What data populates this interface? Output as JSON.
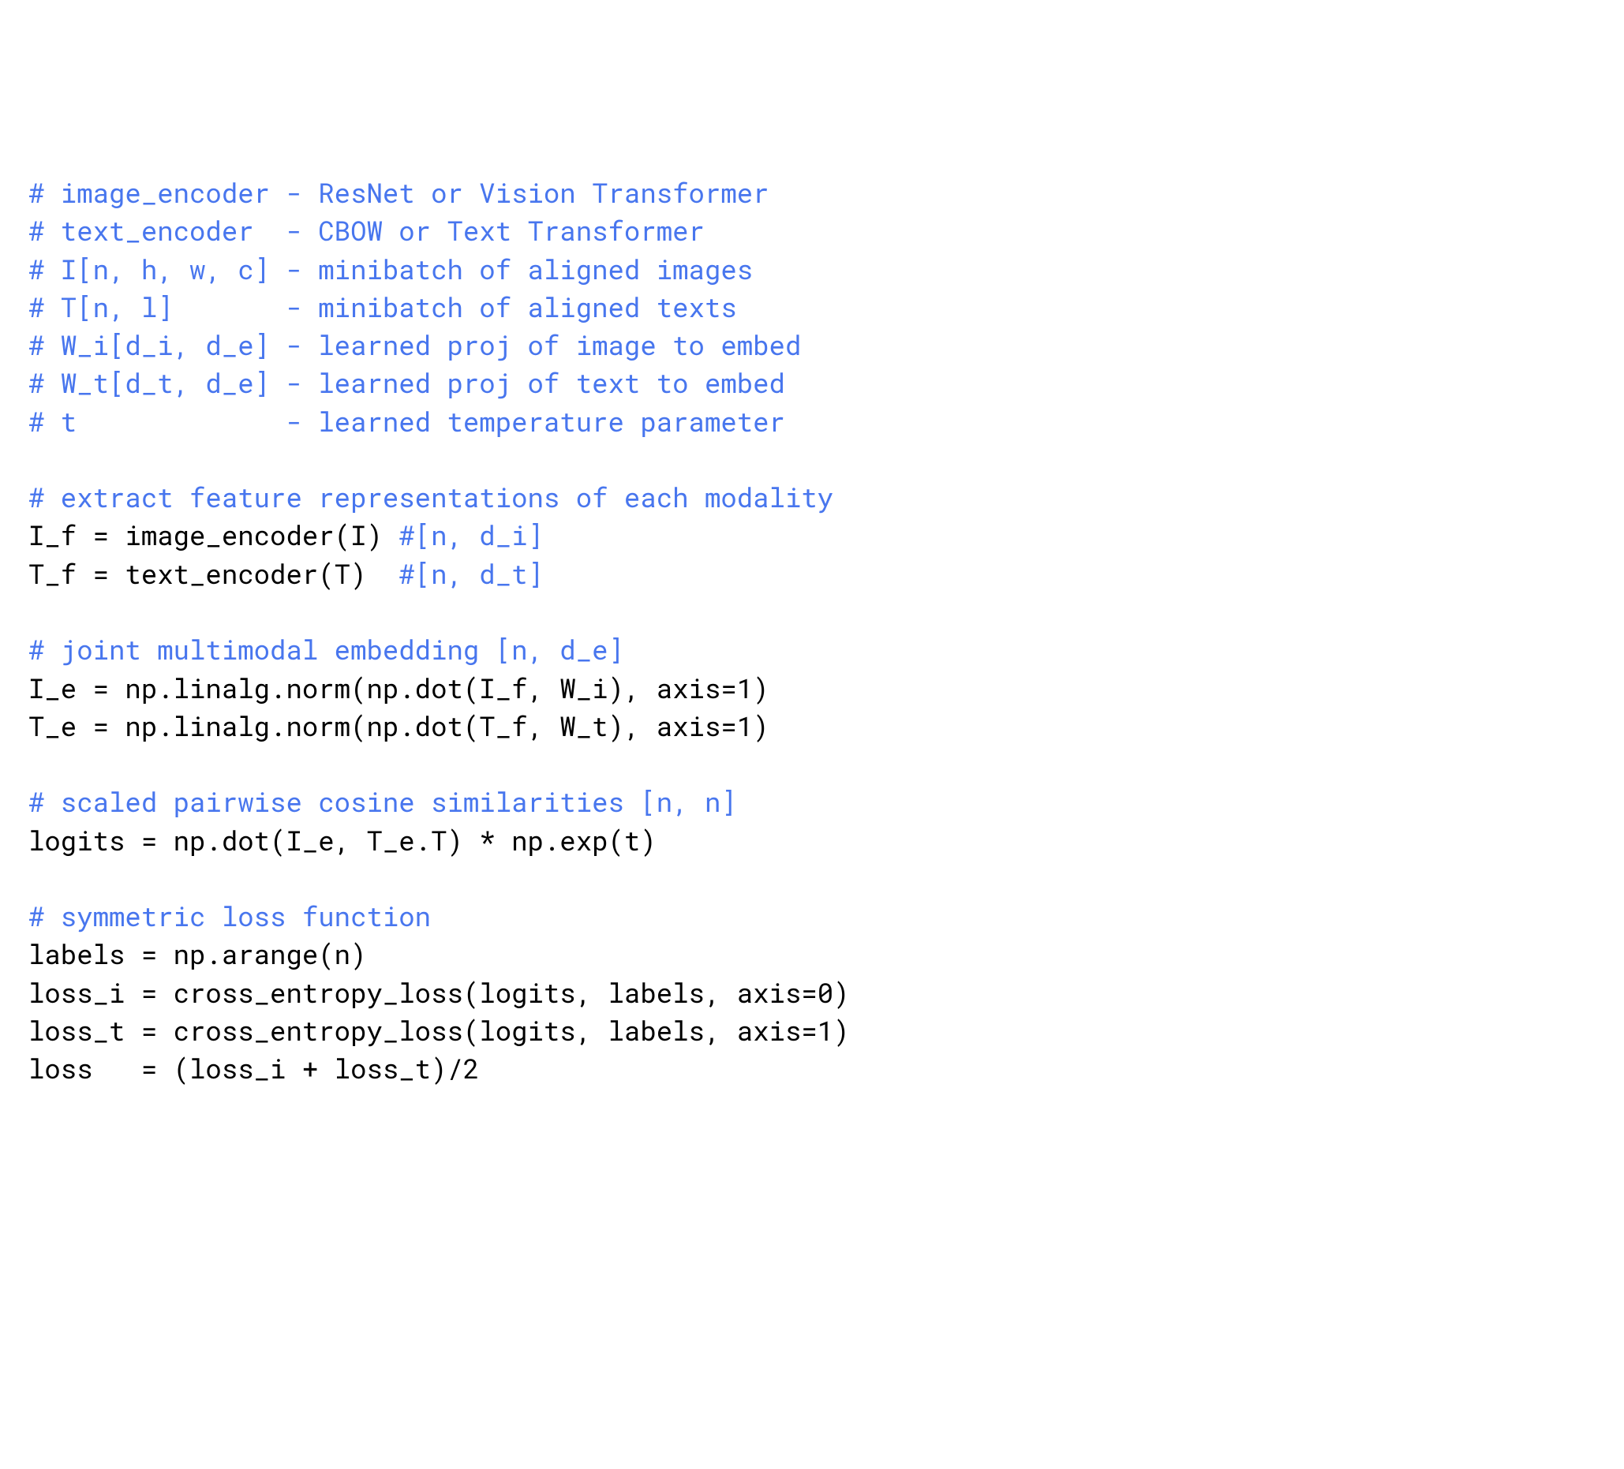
{
  "lines": [
    {
      "segments": [
        {
          "text": "# image_encoder - ResNet or Vision Transformer",
          "type": "comment"
        }
      ]
    },
    {
      "segments": [
        {
          "text": "# text_encoder  - CBOW or Text Transformer",
          "type": "comment"
        }
      ]
    },
    {
      "segments": [
        {
          "text": "# I[n, h, w, c] - minibatch of aligned images",
          "type": "comment"
        }
      ]
    },
    {
      "segments": [
        {
          "text": "# T[n, l]       - minibatch of aligned texts",
          "type": "comment"
        }
      ]
    },
    {
      "segments": [
        {
          "text": "# W_i[d_i, d_e] - learned proj of image to embed",
          "type": "comment"
        }
      ]
    },
    {
      "segments": [
        {
          "text": "# W_t[d_t, d_e] - learned proj of text to embed",
          "type": "comment"
        }
      ]
    },
    {
      "segments": [
        {
          "text": "# t             - learned temperature parameter",
          "type": "comment"
        }
      ]
    },
    {
      "segments": [
        {
          "text": "",
          "type": "code"
        }
      ]
    },
    {
      "segments": [
        {
          "text": "# extract feature representations of each modality",
          "type": "comment"
        }
      ]
    },
    {
      "segments": [
        {
          "text": "I_f = image_encoder(I) ",
          "type": "code"
        },
        {
          "text": "#[n, d_i]",
          "type": "comment"
        }
      ]
    },
    {
      "segments": [
        {
          "text": "T_f = text_encoder(T)  ",
          "type": "code"
        },
        {
          "text": "#[n, d_t]",
          "type": "comment"
        }
      ]
    },
    {
      "segments": [
        {
          "text": "",
          "type": "code"
        }
      ]
    },
    {
      "segments": [
        {
          "text": "# joint multimodal embedding [n, d_e]",
          "type": "comment"
        }
      ]
    },
    {
      "segments": [
        {
          "text": "I_e = np.linalg.norm(np.dot(I_f, W_i), axis=1)",
          "type": "code"
        }
      ]
    },
    {
      "segments": [
        {
          "text": "T_e = np.linalg.norm(np.dot(T_f, W_t), axis=1)",
          "type": "code"
        }
      ]
    },
    {
      "segments": [
        {
          "text": "",
          "type": "code"
        }
      ]
    },
    {
      "segments": [
        {
          "text": "# scaled pairwise cosine similarities [n, n]",
          "type": "comment"
        }
      ]
    },
    {
      "segments": [
        {
          "text": "logits = np.dot(I_e, T_e.T) * np.exp(t)",
          "type": "code"
        }
      ]
    },
    {
      "segments": [
        {
          "text": "",
          "type": "code"
        }
      ]
    },
    {
      "segments": [
        {
          "text": "# symmetric loss function",
          "type": "comment"
        }
      ]
    },
    {
      "segments": [
        {
          "text": "labels = np.arange(n)",
          "type": "code"
        }
      ]
    },
    {
      "segments": [
        {
          "text": "loss_i = cross_entropy_loss(logits, labels, axis=0)",
          "type": "code"
        }
      ]
    },
    {
      "segments": [
        {
          "text": "loss_t = cross_entropy_loss(logits, labels, axis=1)",
          "type": "code"
        }
      ]
    },
    {
      "segments": [
        {
          "text": "loss   = (loss_i + loss_t)/2",
          "type": "code"
        }
      ]
    }
  ]
}
